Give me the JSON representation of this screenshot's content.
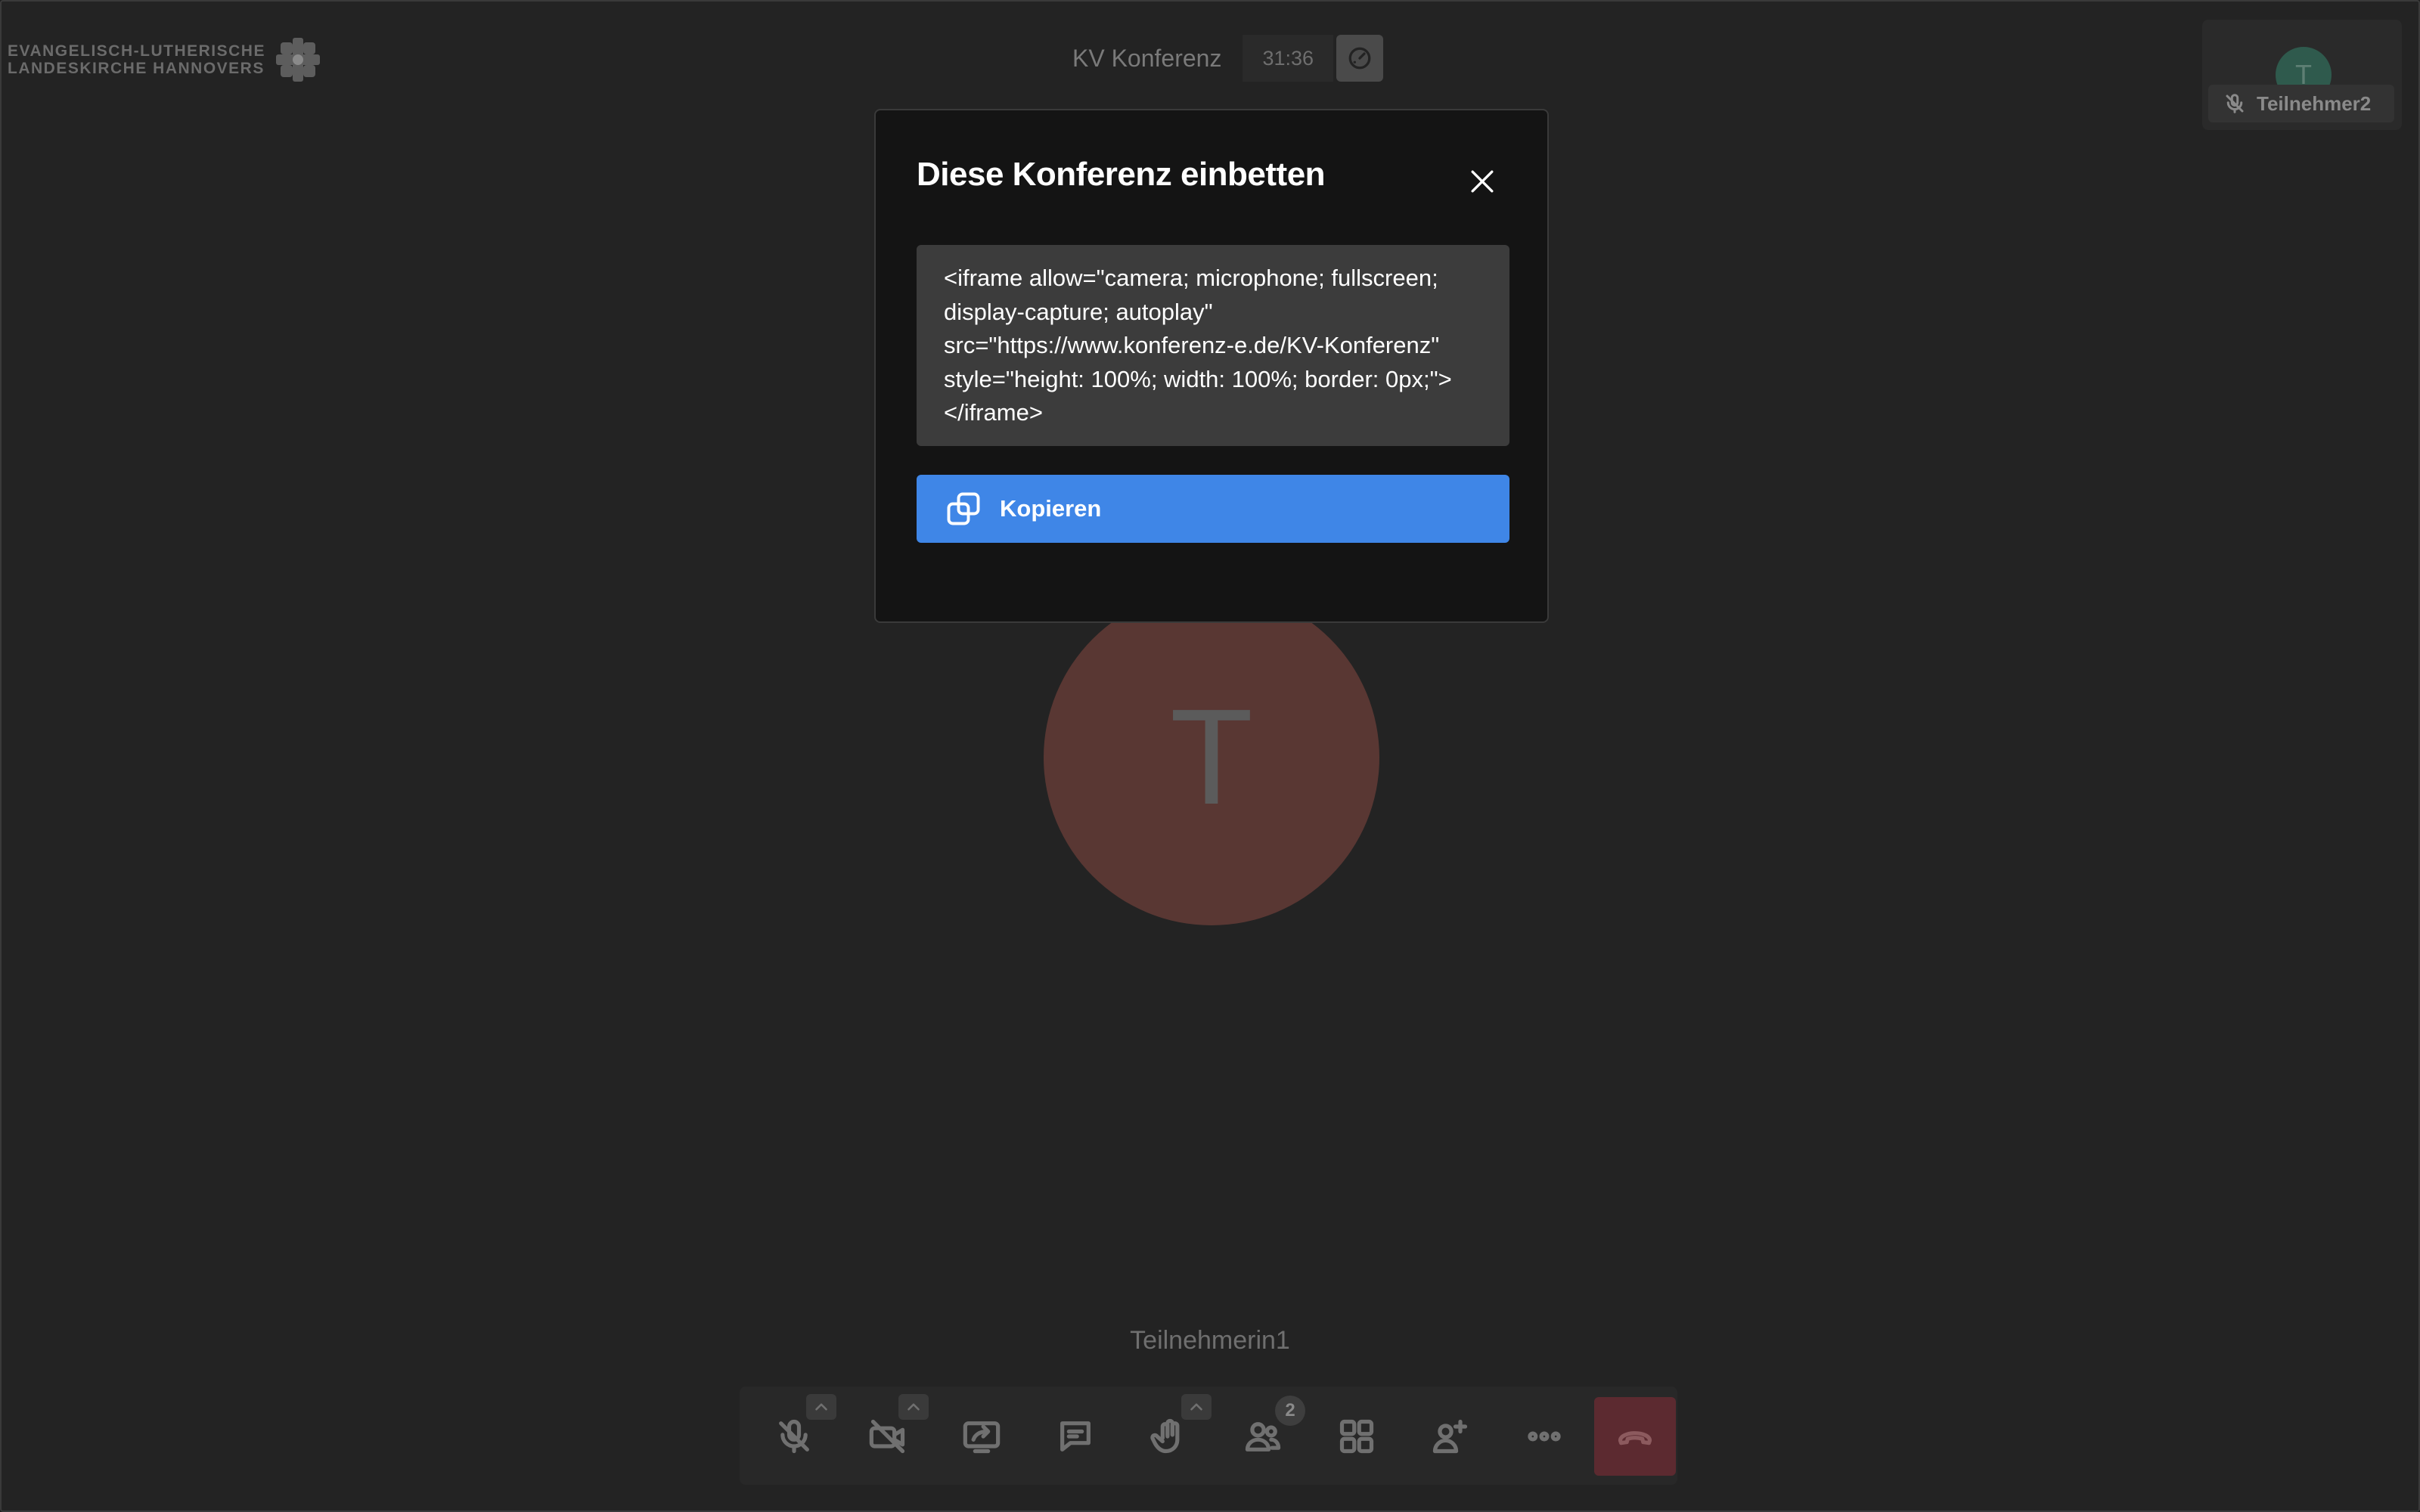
{
  "logo": {
    "line1": "EVANGELISCH-LUTHERISCHE",
    "line2": "LANDESKIRCHE HANNOVERS",
    "icon": "church-cross-icon"
  },
  "conference": {
    "title": "KV Konferenz",
    "timer": "31:36"
  },
  "thumbnail": {
    "avatar_letter": "T",
    "name": "Teilnehmer2",
    "status_icon": "microphone-muted-icon"
  },
  "main_participant": {
    "avatar_letter": "T",
    "name": "Teilnehmerin1"
  },
  "toolbar": {
    "buttons": [
      {
        "name": "microphone",
        "icon": "microphone-muted-icon"
      },
      {
        "name": "camera",
        "icon": "camera-off-icon"
      },
      {
        "name": "screen-share",
        "icon": "screen-share-icon"
      },
      {
        "name": "chat",
        "icon": "chat-icon"
      },
      {
        "name": "raise-hand",
        "icon": "hand-icon"
      },
      {
        "name": "participants",
        "icon": "participants-icon"
      },
      {
        "name": "tile-view",
        "icon": "grid-icon"
      },
      {
        "name": "invite",
        "icon": "add-person-icon"
      },
      {
        "name": "more",
        "icon": "more-icon"
      },
      {
        "name": "hangup",
        "icon": "hangup-icon"
      }
    ],
    "participants_count": "2"
  },
  "modal": {
    "title": "Diese Konferenz einbetten",
    "code": "<iframe allow=\"camera; microphone; fullscreen; display-capture; autoplay\" src=\"https://www.konferenz-e.de/KV-Konferenz\" style=\"height: 100%; width: 100%; border: 0px;\"></iframe>",
    "copy_label": "Kopieren",
    "copy_icon": "copy-icon",
    "close_icon": "close-icon"
  },
  "colors": {
    "accent": "#3f86e7",
    "hangup": "#5c2a30",
    "main_avatar": "#593733",
    "thumb_avatar": "#2f5a4d"
  }
}
